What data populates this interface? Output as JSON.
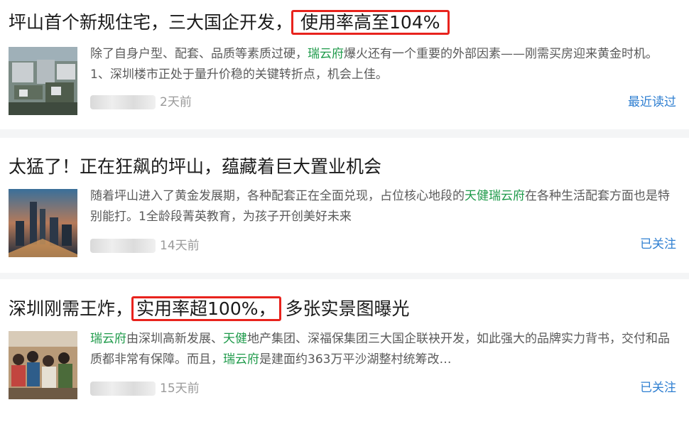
{
  "articles": [
    {
      "title_pre": "坪山首个新规住宅，三大国企开发，",
      "title_hl": "使用率高至104%",
      "title_post": "",
      "desc_parts": [
        {
          "t": "除了自身户型、配套、品质等素质过硬，",
          "kw": false
        },
        {
          "t": "瑞云府",
          "kw": true
        },
        {
          "t": "爆火还有一个重要的外部因素——刚需买房迎来黄金时机。1、深圳楼市正处于量升价稳的关键转折点，机会上佳。",
          "kw": false
        }
      ],
      "time": "2天前",
      "action": "最近读过"
    },
    {
      "title_pre": "太猛了！正在狂飙的坪山，蕴藏着巨大置业机会",
      "title_hl": "",
      "title_post": "",
      "desc_parts": [
        {
          "t": "随着坪山进入了黄金发展期，各种配套正在全面兑现，占位核心地段的",
          "kw": false
        },
        {
          "t": "天健瑞云府",
          "kw": true
        },
        {
          "t": "在各种生活配套方面也是特别能打。1全龄段菁英教育，为孩子开创美好未来",
          "kw": false
        }
      ],
      "time": "14天前",
      "action": "已关注"
    },
    {
      "title_pre": "深圳刚需王炸，",
      "title_hl": "实用率超100%，",
      "title_post": "多张实景图曝光",
      "desc_parts": [
        {
          "t": "瑞云府",
          "kw": true
        },
        {
          "t": "由深圳高新发展、",
          "kw": false
        },
        {
          "t": "天健",
          "kw": true
        },
        {
          "t": "地产集团、深福保集团三大国企联袂开发，如此强大的品牌实力背书，交付和品质都非常有保障。而且，",
          "kw": false
        },
        {
          "t": "瑞云府",
          "kw": true
        },
        {
          "t": "是建面约363万平沙湖整村统筹改…",
          "kw": false
        }
      ],
      "time": "15天前",
      "action": "已关注"
    }
  ],
  "colors": {
    "highlight_border": "#e8231d",
    "keyword": "#1e9a4a",
    "action_link": "#2f7fd1"
  }
}
